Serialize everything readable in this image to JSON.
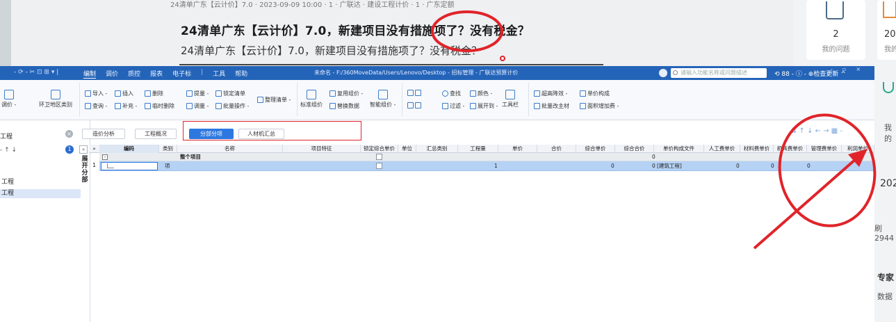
{
  "bg_page": {
    "meta_line": "24清单广东【云计价】7.0 · 2023-09-09 10:00 · 1 · 广联达  ·  建设工程计价 · 1  ·  广东定额",
    "article_title": "24清单广东【云计价】7.0，新建项目没有措施项了？没有税金？",
    "article_subtitle": "24清单广东【云计价】7.0，新建项目没有措施项了？没有税金？",
    "stat_count": "2",
    "stat_label": "我的问题",
    "stat2_count": "20",
    "stat2_label": "我的",
    "side_text_1": "我的",
    "side_text_2": "202",
    "side_text_3": "刷2944",
    "side_text_4": "专家",
    "side_text_5": "数据"
  },
  "window": {
    "quick_access": "- ⟳ - ✂ ⊡ ⊞ ▾ |",
    "menus": [
      "编制",
      "调价",
      "质控",
      "报表",
      "电子标",
      "工具",
      "帮助"
    ],
    "active_menu": "编制",
    "title": "未命名 - F:/360MoveData/Users/Lenovo/Desktop - 招标管理 - 广联达预算计价",
    "search_placeholder": "请输入功能名称或问题描述",
    "right_tools": "⟲ 88 - ⓘ - ⊕检查更新   ^",
    "win_controls": [
      "-",
      "▫",
      "×"
    ]
  },
  "ribbon": {
    "big_1": "调价 -",
    "big_2": "环卫地区类别",
    "import": "导入 -",
    "insert": "插入",
    "delete": "删除",
    "query": "查询 -",
    "supplement": "补充 -",
    "temp_delete": "临时删除",
    "amount": "提量 -",
    "lock_list": "锁定清单",
    "organize_list": "整理清单 -",
    "adjust": "调量 -",
    "batch_op": "批量操作 -",
    "std_price": "标准组价",
    "reuse_price": "复用组价 -",
    "replace_data": "替换数据",
    "smart_price": "智能组价 -",
    "find": "查找",
    "color": "颜色 -",
    "toolbar": "工具栏",
    "filter": "过滤 -",
    "expand": "展开到 -",
    "elev_reduce": "超高降效 -",
    "unit_comp": "单价构成",
    "batch_main": "批量改主材",
    "area_add": "面积增加费 -"
  },
  "left_panel": {
    "header": "工程",
    "tools": "- ↑ ↓",
    "badge": "1",
    "collapse": "»",
    "items": [
      "工程",
      "工程"
    ],
    "vertical_tab": "展开分部"
  },
  "tabs": {
    "items": [
      "造价分析",
      "工程概况",
      "分部分项",
      "人材机汇总"
    ],
    "active": "分部分项",
    "right_tools": "⇊ ↑ ↓ ← → ▦ -"
  },
  "grid": {
    "columns": [
      "编码",
      "类别",
      "名称",
      "项目特征",
      "锁定综合单价",
      "单位",
      "汇总类别",
      "工程量",
      "单价",
      "合价",
      "综合单价",
      "综合合价",
      "单价构成文件",
      "人工费单价",
      "材料费单价",
      "机具费单价",
      "管理费单价",
      "利润单价"
    ],
    "row_whole": {
      "minus": "-",
      "name": "整个项目",
      "total": "0"
    },
    "row_1": {
      "num": "1",
      "category": "项",
      "quantity": "1",
      "unit_price_sum": "0",
      "total_sum": "0",
      "price_file": "[建筑工程]",
      "labor": "0",
      "material": "0",
      "machine": "0"
    }
  },
  "annotations": {
    "circle_color": "#e0242a",
    "arrow_color": "#e0242a"
  }
}
